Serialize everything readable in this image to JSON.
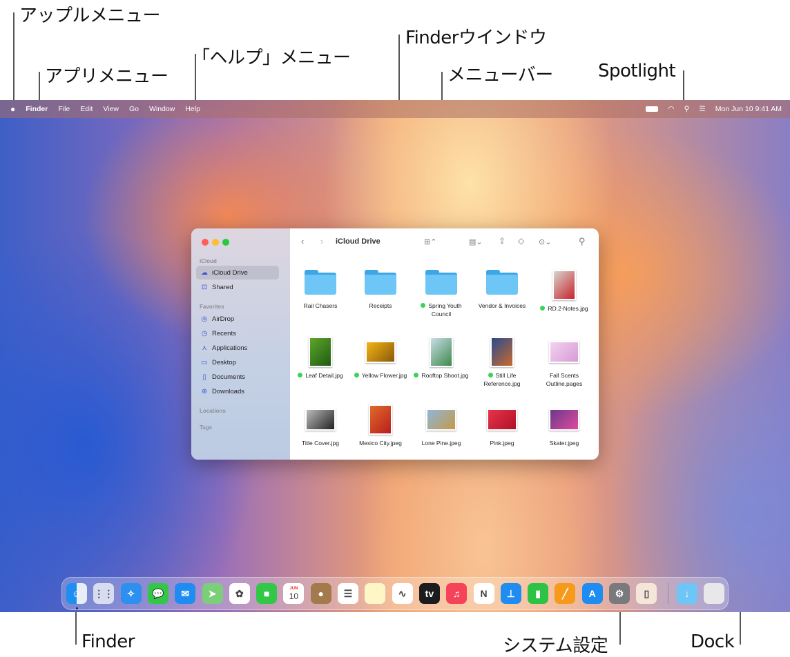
{
  "callouts": {
    "apple_menu": "アップルメニュー",
    "app_menu": "アプリメニュー",
    "help_menu": "「ヘルプ」メニュー",
    "finder_window": "Finderウインドウ",
    "menu_bar": "メニューバー",
    "spotlight": "Spotlight",
    "finder": "Finder",
    "system_settings": "システム設定",
    "dock": "Dock"
  },
  "menubar": {
    "apple": "",
    "items": [
      "Finder",
      "File",
      "Edit",
      "View",
      "Go",
      "Window",
      "Help"
    ],
    "clock": "Mon Jun 10  9:41 AM"
  },
  "finder": {
    "title": "iCloud Drive",
    "sidebar": {
      "sections": [
        "iCloud",
        "Favorites",
        "Locations",
        "Tags"
      ],
      "icloud_items": [
        {
          "label": "iCloud Drive",
          "icon": "☁"
        },
        {
          "label": "Shared",
          "icon": "⊡"
        }
      ],
      "favorite_items": [
        {
          "label": "AirDrop",
          "icon": "◎"
        },
        {
          "label": "Recents",
          "icon": "◷"
        },
        {
          "label": "Applications",
          "icon": "⋏"
        },
        {
          "label": "Desktop",
          "icon": "▭"
        },
        {
          "label": "Documents",
          "icon": "▯"
        },
        {
          "label": "Downloads",
          "icon": "⊕"
        }
      ]
    },
    "files": [
      {
        "name": "Rail Chasers",
        "kind": "folder",
        "tag": false
      },
      {
        "name": "Receipts",
        "kind": "folder",
        "tag": false
      },
      {
        "name": "Spring Youth Council",
        "kind": "folder",
        "tag": true
      },
      {
        "name": "Vendor & Invoices",
        "kind": "folder",
        "tag": false
      },
      {
        "name": "RD.2-Notes.jpg",
        "kind": "image",
        "tag": true,
        "colors": [
          "#d8d4cf",
          "#c8242c"
        ],
        "shape": "portrait"
      },
      {
        "name": "Leaf Detail.jpg",
        "kind": "image",
        "tag": true,
        "colors": [
          "#5da52b",
          "#1f5c12"
        ],
        "shape": "portrait"
      },
      {
        "name": "Yellow Flower.jpg",
        "kind": "image",
        "tag": true,
        "colors": [
          "#f2b418",
          "#8a5a08"
        ],
        "shape": "landscape"
      },
      {
        "name": "Rooftop Shoot.jpg",
        "kind": "image",
        "tag": true,
        "colors": [
          "#c9dce8",
          "#3d8a4a"
        ],
        "shape": "portrait"
      },
      {
        "name": "Still Life Reference.jpg",
        "kind": "image",
        "tag": true,
        "colors": [
          "#284a8c",
          "#c96a30"
        ],
        "shape": "portrait"
      },
      {
        "name": "Fall Scents Outline.pages",
        "kind": "image",
        "tag": false,
        "colors": [
          "#f3d2ef",
          "#d79bd6"
        ],
        "shape": "landscape"
      },
      {
        "name": "Title Cover.jpg",
        "kind": "image",
        "tag": false,
        "colors": [
          "#bbbbbb",
          "#222222"
        ],
        "shape": "landscape"
      },
      {
        "name": "Mexico City.jpeg",
        "kind": "image",
        "tag": false,
        "colors": [
          "#e06a2a",
          "#b91e1e"
        ],
        "shape": "portrait"
      },
      {
        "name": "Lone Pine.jpeg",
        "kind": "image",
        "tag": false,
        "colors": [
          "#8fb6d8",
          "#c49a4a"
        ],
        "shape": "landscape"
      },
      {
        "name": "Pink.jpeg",
        "kind": "image",
        "tag": false,
        "colors": [
          "#e8344a",
          "#b01028"
        ],
        "shape": "landscape"
      },
      {
        "name": "Skater.jpeg",
        "kind": "image",
        "tag": false,
        "colors": [
          "#6a3a8a",
          "#e04aa0"
        ],
        "shape": "landscape"
      }
    ]
  },
  "dock": {
    "apps": [
      {
        "icon": "finder-icon",
        "bg": "linear-gradient(90deg,#1e8ff0 50%,#e8eef6 50%)",
        "glyph": "☺"
      },
      {
        "icon": "launchpad-icon",
        "bg": "#d7dcf0",
        "glyph": "⋮⋮"
      },
      {
        "icon": "safari-icon",
        "bg": "#2d8ff0",
        "glyph": "✧"
      },
      {
        "icon": "messages-icon",
        "bg": "#33c748",
        "glyph": "💬"
      },
      {
        "icon": "mail-icon",
        "bg": "#1f8cf2",
        "glyph": "✉"
      },
      {
        "icon": "maps-icon",
        "bg": "#7ccf7a",
        "glyph": "➤"
      },
      {
        "icon": "photos-icon",
        "bg": "#ffffff",
        "glyph": "✿"
      },
      {
        "icon": "facetime-icon",
        "bg": "#33c748",
        "glyph": "■"
      },
      {
        "icon": "calendar-icon",
        "bg": "#ffffff",
        "glyph": "10",
        "top": "JUN"
      },
      {
        "icon": "contacts-icon",
        "bg": "#a27a4c",
        "glyph": "●"
      },
      {
        "icon": "reminders-icon",
        "bg": "#ffffff",
        "glyph": "☰"
      },
      {
        "icon": "notes-icon",
        "bg": "#fff6c8",
        "glyph": ""
      },
      {
        "icon": "freeform-icon",
        "bg": "#ffffff",
        "glyph": "∿"
      },
      {
        "icon": "tv-icon",
        "bg": "#1c1c1e",
        "glyph": "tv"
      },
      {
        "icon": "music-icon",
        "bg": "#f5435a",
        "glyph": "♫"
      },
      {
        "icon": "news-icon",
        "bg": "#ffffff",
        "glyph": "N"
      },
      {
        "icon": "keynote-icon",
        "bg": "#1e8cf0",
        "glyph": "⊥"
      },
      {
        "icon": "numbers-icon",
        "bg": "#2fc345",
        "glyph": "▮"
      },
      {
        "icon": "pages-icon",
        "bg": "#f59a1a",
        "glyph": "╱"
      },
      {
        "icon": "app-store-icon",
        "bg": "#1f8cf2",
        "glyph": "A"
      },
      {
        "icon": "system-settings-icon",
        "bg": "#7a7a7e",
        "glyph": "⚙"
      },
      {
        "icon": "iphone-mirroring-icon",
        "bg": "#f4e6d8",
        "glyph": "▯"
      }
    ],
    "right": [
      {
        "icon": "downloads-folder-icon",
        "bg": "#6ec6f7",
        "glyph": "↓"
      },
      {
        "icon": "trash-icon",
        "bg": "#e8e8ea",
        "glyph": ""
      }
    ]
  }
}
